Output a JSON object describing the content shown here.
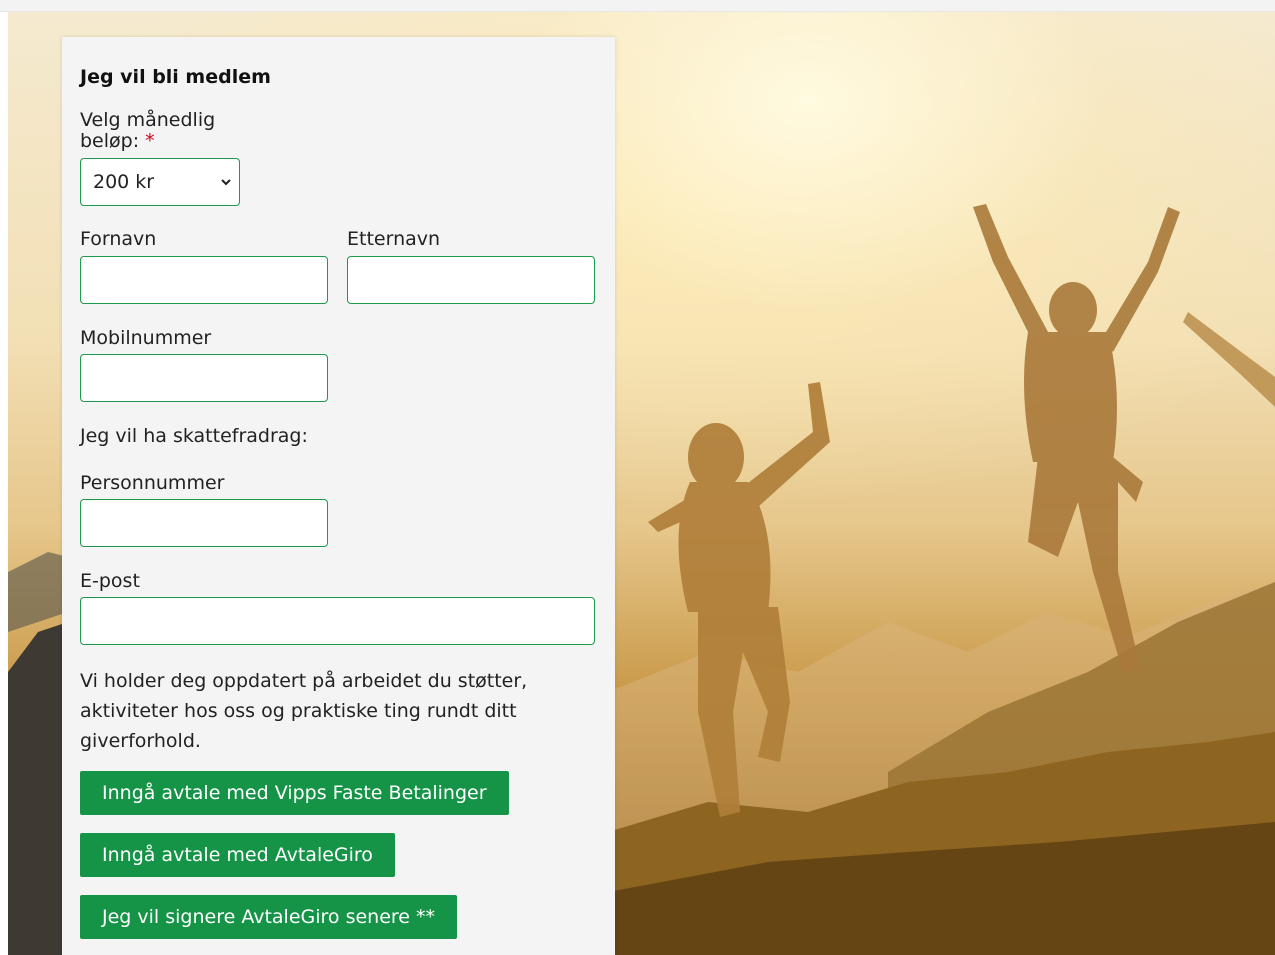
{
  "form": {
    "title": "Jeg vil bli medlem",
    "amount_label_line1": "Velg månedlig",
    "amount_label_line2": "beløp:",
    "required_marker": "*",
    "amount_selected": "200 kr",
    "first_name_label": "Fornavn",
    "last_name_label": "Etternavn",
    "mobile_label": "Mobilnummer",
    "tax_deduction_text": "Jeg vil ha skattefradrag:",
    "personal_number_label": "Personnummer",
    "email_label": "E-post",
    "info_text": "Vi holder deg oppdatert på arbeidet du støtter, aktiviteter hos oss og praktiske ting rundt ditt giverforhold.",
    "buttons": {
      "vipps": "Inngå avtale med Vipps Faste Betalinger",
      "avtalegiro": "Inngå avtale med AvtaleGiro",
      "later": "Jeg vil signere AvtaleGiro senere **"
    }
  },
  "icons": {
    "select_chevron": "chevron-down-icon"
  },
  "colors": {
    "accent_green": "#159447",
    "required_red": "#d0021b",
    "panel_bg": "#f4f4f4"
  }
}
